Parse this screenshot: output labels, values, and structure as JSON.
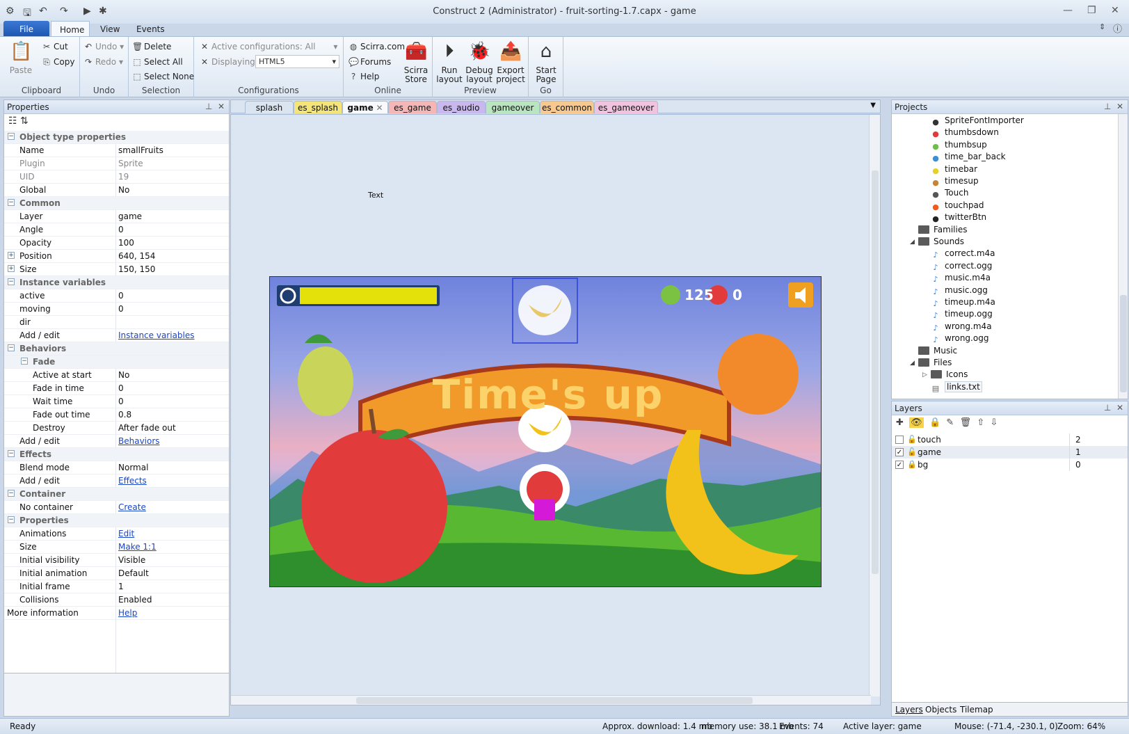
{
  "window": {
    "title": "Construct 2 (Administrator) - fruit-sorting-1.7.capx - game"
  },
  "ribbon_tabs": [
    "File",
    "Home",
    "View",
    "Events"
  ],
  "clipboard": {
    "paste": "Paste",
    "cut": "Cut",
    "copy": "Copy",
    "label": "Clipboard"
  },
  "undo": {
    "undo": "Undo",
    "redo": "Redo",
    "label": "Undo"
  },
  "selection": {
    "delete": "Delete",
    "select_all": "Select All",
    "select_none": "Select None",
    "label": "Selection"
  },
  "configurations": {
    "active": "Active configurations: All",
    "displaying_label": "Displaying:",
    "displaying_value": "HTML5",
    "label": "Configurations"
  },
  "online": {
    "scirra": "Scirra.com",
    "forums": "Forums",
    "help": "Help",
    "store_line1": "Scirra",
    "store_line2": "Store",
    "label": "Online"
  },
  "preview": {
    "run_line1": "Run",
    "run_line2": "layout",
    "debug_line1": "Debug",
    "debug_line2": "layout",
    "export_line1": "Export",
    "export_line2": "project",
    "label": "Preview"
  },
  "go": {
    "start_line1": "Start",
    "start_line2": "Page",
    "label": "Go"
  },
  "properties": {
    "title": "Properties",
    "rows": [
      {
        "t": "cat",
        "k": "Object type properties"
      },
      {
        "k": "Name",
        "v": "smallFruits"
      },
      {
        "k": "Plugin",
        "v": "Sprite",
        "grey": true
      },
      {
        "k": "UID",
        "v": "19",
        "grey": true
      },
      {
        "k": "Global",
        "v": "No"
      },
      {
        "t": "cat",
        "k": "Common"
      },
      {
        "k": "Layer",
        "v": "game"
      },
      {
        "k": "Angle",
        "v": "0"
      },
      {
        "k": "Opacity",
        "v": "100"
      },
      {
        "k": "Position",
        "v": "640, 154",
        "exp": true
      },
      {
        "k": "Size",
        "v": "150, 150",
        "exp": true
      },
      {
        "t": "cat",
        "k": "Instance variables"
      },
      {
        "k": "active",
        "v": "0"
      },
      {
        "k": "moving",
        "v": "0"
      },
      {
        "k": "dir",
        "v": ""
      },
      {
        "k": "Add / edit",
        "v": "Instance variables",
        "link": true
      },
      {
        "t": "cat",
        "k": "Behaviors"
      },
      {
        "t": "sub",
        "k": "Fade"
      },
      {
        "k": "Active at start",
        "v": "No",
        "indent": true
      },
      {
        "k": "Fade in time",
        "v": "0",
        "indent": true
      },
      {
        "k": "Wait time",
        "v": "0",
        "indent": true
      },
      {
        "k": "Fade out time",
        "v": "0.8",
        "indent": true
      },
      {
        "k": "Destroy",
        "v": "After fade out",
        "indent": true
      },
      {
        "k": "Add / edit",
        "v": "Behaviors",
        "link": true
      },
      {
        "t": "cat",
        "k": "Effects"
      },
      {
        "k": "Blend mode",
        "v": "Normal"
      },
      {
        "k": "Add / edit",
        "v": "Effects",
        "link": true
      },
      {
        "t": "cat",
        "k": "Container"
      },
      {
        "k": "No container",
        "v": "Create",
        "link": true
      },
      {
        "t": "cat",
        "k": "Properties"
      },
      {
        "k": "Animations",
        "v": "Edit",
        "link": true
      },
      {
        "k": "Size",
        "v": "Make 1:1",
        "link": true
      },
      {
        "k": "Initial visibility",
        "v": "Visible"
      },
      {
        "k": "Initial animation",
        "v": "Default"
      },
      {
        "k": "Initial frame",
        "v": "1"
      },
      {
        "k": "Collisions",
        "v": "Enabled"
      },
      {
        "t": "more",
        "k": "More information",
        "v": "Help",
        "link": true
      }
    ]
  },
  "layout_tabs": [
    {
      "label": "splash",
      "color": "#dbe5f1"
    },
    {
      "label": "es_splash",
      "color": "#f3e57a"
    },
    {
      "label": "game",
      "color": "#f7f9fc",
      "active": true
    },
    {
      "label": "es_game",
      "color": "#f4b6b6"
    },
    {
      "label": "es_audio",
      "color": "#c9b8ee"
    },
    {
      "label": "gameover",
      "color": "#b9e6c0"
    },
    {
      "label": "es_common",
      "color": "#f7c98e"
    },
    {
      "label": "es_gameover",
      "color": "#f1c3df"
    }
  ],
  "canvas": {
    "text_object": "Text",
    "score_correct": "125",
    "score_wrong": "0",
    "banner": "Time's up"
  },
  "projects": {
    "title": "Projects",
    "items": [
      {
        "label": "SpriteFontImporter",
        "icon": "sprite-font-icon",
        "color": "#333"
      },
      {
        "label": "thumbsdown",
        "icon": "thumbsdown-icon",
        "color": "#e03a3a"
      },
      {
        "label": "thumbsup",
        "icon": "thumbsup-icon",
        "color": "#6cc04a"
      },
      {
        "label": "time_bar_back",
        "icon": "bar-back-icon",
        "color": "#3a8fd6"
      },
      {
        "label": "timebar",
        "icon": "timebar-icon",
        "color": "#e6d12a"
      },
      {
        "label": "timesup",
        "icon": "timesup-icon",
        "color": "#c9823a"
      },
      {
        "label": "Touch",
        "icon": "touch-icon",
        "color": "#555"
      },
      {
        "label": "touchpad",
        "icon": "touchpad-icon",
        "color": "#f05a1a"
      },
      {
        "label": "twitterBtn",
        "icon": "twitter-icon",
        "color": "#222"
      },
      {
        "label": "Families",
        "folder": true,
        "level": 1
      },
      {
        "label": "Sounds",
        "folder": true,
        "level": 1,
        "open": true
      },
      {
        "label": "correct.m4a",
        "icon": "sound-file-icon",
        "color": "#3a7bd5"
      },
      {
        "label": "correct.ogg",
        "icon": "sound-file-icon",
        "color": "#3a7bd5"
      },
      {
        "label": "music.m4a",
        "icon": "sound-file-icon",
        "color": "#3a7bd5"
      },
      {
        "label": "music.ogg",
        "icon": "sound-file-icon",
        "color": "#3a7bd5"
      },
      {
        "label": "timeup.m4a",
        "icon": "sound-file-icon",
        "color": "#3a7bd5"
      },
      {
        "label": "timeup.ogg",
        "icon": "sound-file-icon",
        "color": "#3a7bd5"
      },
      {
        "label": "wrong.m4a",
        "icon": "sound-file-icon",
        "color": "#3a7bd5"
      },
      {
        "label": "wrong.ogg",
        "icon": "sound-file-icon",
        "color": "#3a7bd5"
      },
      {
        "label": "Music",
        "folder": true,
        "level": 1
      },
      {
        "label": "Files",
        "folder": true,
        "level": 1,
        "open": true
      },
      {
        "label": "Icons",
        "folder": true,
        "level": 2,
        "collapsed": true
      },
      {
        "label": "links.txt",
        "icon": "text-file-icon",
        "color": "#666"
      }
    ]
  },
  "layers": {
    "title": "Layers",
    "rows": [
      {
        "name": "touch",
        "num": "2",
        "checked": false
      },
      {
        "name": "game",
        "num": "1",
        "checked": true,
        "selected": true
      },
      {
        "name": "bg",
        "num": "0",
        "checked": true,
        "locked": true
      }
    ],
    "bottom_tabs": [
      "Layers",
      "Objects",
      "Tilemap"
    ]
  },
  "status": {
    "ready": "Ready",
    "download": "Approx. download: 1.4 mb",
    "memory": "memory use: 38.1 mb",
    "events": "Events: 74",
    "active_layer": "Active layer: game",
    "mouse": "Mouse: (-71.4, -230.1, 0)",
    "zoom": "Zoom: 64%"
  }
}
